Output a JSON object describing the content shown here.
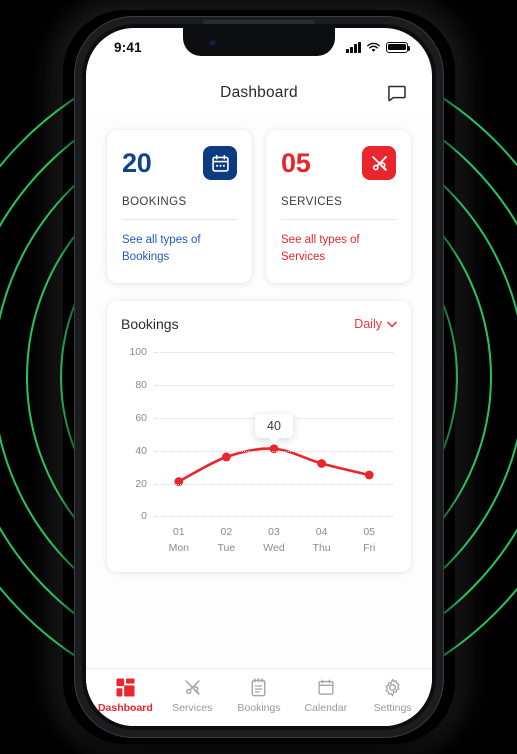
{
  "colors": {
    "brand_red": "#e8262c",
    "brand_blue": "#0c3b82",
    "link_blue": "#1e5bbf",
    "ring_green": "#22C55E",
    "screen_bg": "#fdfdfd"
  },
  "status_bar": {
    "time": "9:41",
    "signal_icon": "cellular-signal-icon",
    "wifi_icon": "wifi-icon",
    "battery_icon": "battery-full-icon"
  },
  "header": {
    "title": "Dashboard",
    "chat_icon": "chat-bubble-icon"
  },
  "stat_cards": [
    {
      "value": "20",
      "label": "BOOKINGS",
      "link": "See all types of Bookings",
      "icon": "calendar-icon",
      "accent": "#0c3b82"
    },
    {
      "value": "05",
      "label": "SERVICES",
      "link": "See all types of Services",
      "icon": "tools-icon",
      "accent": "#e8262c"
    }
  ],
  "chart_card": {
    "title": "Bookings",
    "period_label": "Daily",
    "period_chevron_icon": "chevron-down-icon",
    "tooltip_value": "40"
  },
  "chart_data": {
    "type": "line",
    "title": "Bookings",
    "xlabel": "",
    "ylabel": "",
    "ylim": [
      0,
      100
    ],
    "yticks": [
      0,
      20,
      40,
      60,
      80,
      100
    ],
    "ytick_labels": [
      "0",
      "20",
      "40",
      "60",
      "80",
      "100"
    ],
    "grid": true,
    "legend": "none",
    "categories": [
      "01",
      "02",
      "03",
      "04",
      "05"
    ],
    "category_sublabels": [
      "Mon",
      "Tue",
      "Wed",
      "Thu",
      "Fri"
    ],
    "series": [
      {
        "name": "Bookings",
        "color": "#e8262c",
        "values": [
          21,
          36,
          41,
          32,
          25
        ]
      }
    ],
    "annotations": [
      {
        "label": "40",
        "at_category": "03",
        "at_value": 41
      }
    ]
  },
  "bottom_nav": {
    "active_index": 0,
    "items": [
      {
        "label": "Dashboard",
        "icon": "grid-dashboard-icon"
      },
      {
        "label": "Services",
        "icon": "tools-icon"
      },
      {
        "label": "Bookings",
        "icon": "notepad-icon"
      },
      {
        "label": "Calendar",
        "icon": "calendar-icon"
      },
      {
        "label": "Settings",
        "icon": "gear-icon"
      }
    ]
  }
}
